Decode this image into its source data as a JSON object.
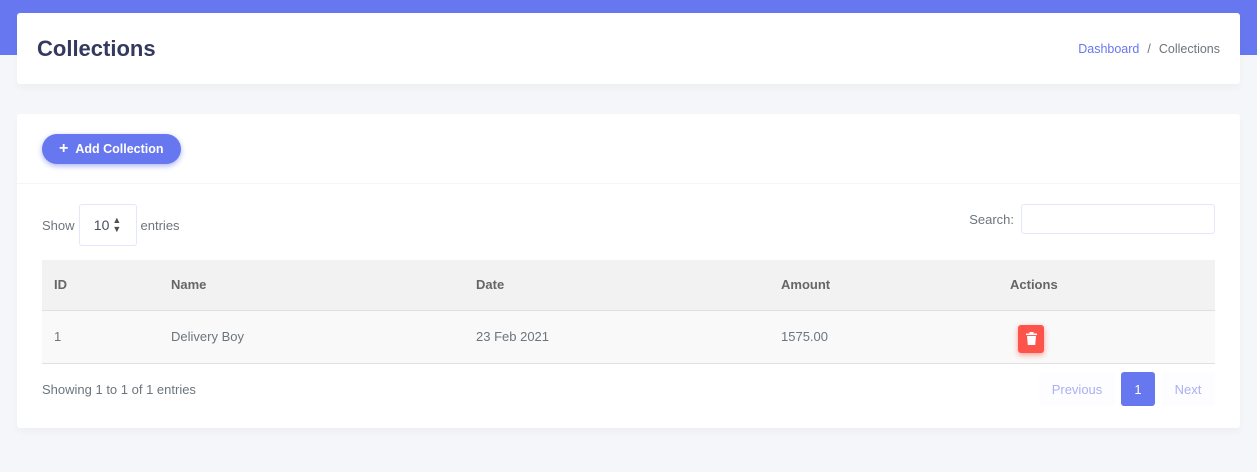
{
  "header": {
    "title": "Collections",
    "breadcrumb": {
      "link": "Dashboard",
      "separator": "/",
      "current": "Collections"
    }
  },
  "toolbar": {
    "add_label": "Add Collection",
    "add_icon": "plus-icon"
  },
  "controls": {
    "show_label": "Show",
    "length_value": "10",
    "entries_label": "entries",
    "search_label": "Search:",
    "search_value": ""
  },
  "table": {
    "columns": [
      "ID",
      "Name",
      "Date",
      "Amount",
      "Actions"
    ],
    "rows": [
      {
        "id": "1",
        "name": "Delivery Boy",
        "date": "23 Feb 2021",
        "amount": "1575.00",
        "action_icon": "trash-icon"
      }
    ]
  },
  "footer": {
    "info": "Showing 1 to 1 of 1 entries",
    "previous": "Previous",
    "page": "1",
    "next": "Next"
  },
  "colors": {
    "primary": "#6777ef",
    "danger": "#fc544b",
    "background": "#f4f6f9"
  }
}
